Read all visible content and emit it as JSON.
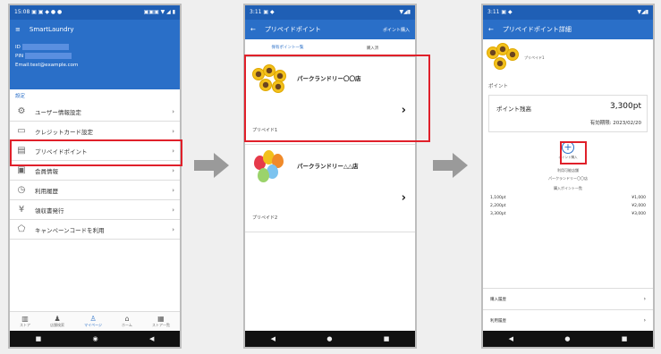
{
  "phone1": {
    "status_left": "15:08 ▣ ▣ ◆ ● ●",
    "status_right": "▣▣▣ ▼ ◢ ▮",
    "app_title": "SmartLaundry",
    "profile": {
      "id_label": "ID",
      "pin_label": "PIN",
      "email": "Email:test@example.com"
    },
    "section_label": "設定",
    "menu": [
      {
        "label": "ユーザー情報設定",
        "icon": "gear-icon",
        "glyph": "⚙"
      },
      {
        "label": "クレジットカード設定",
        "icon": "credit-card-icon",
        "glyph": "▭"
      },
      {
        "label": "プリペイドポイント",
        "icon": "calendar-icon",
        "glyph": "▤"
      },
      {
        "label": "会員情報",
        "icon": "id-card-icon",
        "glyph": "▣"
      },
      {
        "label": "利用履歴",
        "icon": "history-clock-icon",
        "glyph": "◷"
      },
      {
        "label": "領収書発行",
        "icon": "yen-icon",
        "glyph": "¥"
      },
      {
        "label": "キャンペーンコードを利用",
        "icon": "tag-icon",
        "glyph": "⬠"
      }
    ],
    "tabs": [
      {
        "label": "ストア",
        "icon": "store-icon",
        "glyph": "▥"
      },
      {
        "label": "店舗検索",
        "icon": "people-icon",
        "glyph": "♟"
      },
      {
        "label": "マイページ",
        "icon": "user-icon",
        "glyph": "♙"
      },
      {
        "label": "ホーム",
        "icon": "home-icon",
        "glyph": "⌂"
      },
      {
        "label": "ストア一覧",
        "icon": "shop-icon",
        "glyph": "▦"
      }
    ]
  },
  "phone2": {
    "status_left": "3:11 ▣ ◆",
    "status_right": "▼◢▮",
    "title": "プリペイドポイント",
    "action": "ポイント購入",
    "tabs": [
      "保有ポイント一覧",
      "購入済"
    ],
    "cards": [
      {
        "name": "パークランドリー〇〇店",
        "sub": "プリペイド1"
      },
      {
        "name": "パークランドリー△△店",
        "sub": "プリペイド2"
      }
    ]
  },
  "phone3": {
    "status_left": "3:11 ▣ ◆",
    "status_right": "▼◢▮",
    "title": "プリペイドポイント詳細",
    "store_small": "プリペイド1",
    "section": "ポイント",
    "points_label": "ポイント残高",
    "points_value": "3,300pt",
    "expiry": "有効期限: 2023/02/20",
    "charge_label": "ポイント購入",
    "usable_label": "利用可能店舗",
    "usable_store": "パークランドリー〇〇店",
    "breakdown_label": "購入ポイント一覧",
    "breakdown": [
      {
        "left": "1,100pt",
        "right": "¥1,000"
      },
      {
        "left": "2,200pt",
        "right": "¥2,000"
      },
      {
        "left": "3,300pt",
        "right": "¥3,000"
      }
    ],
    "links": [
      "購入履歴",
      "利用履歴"
    ]
  }
}
